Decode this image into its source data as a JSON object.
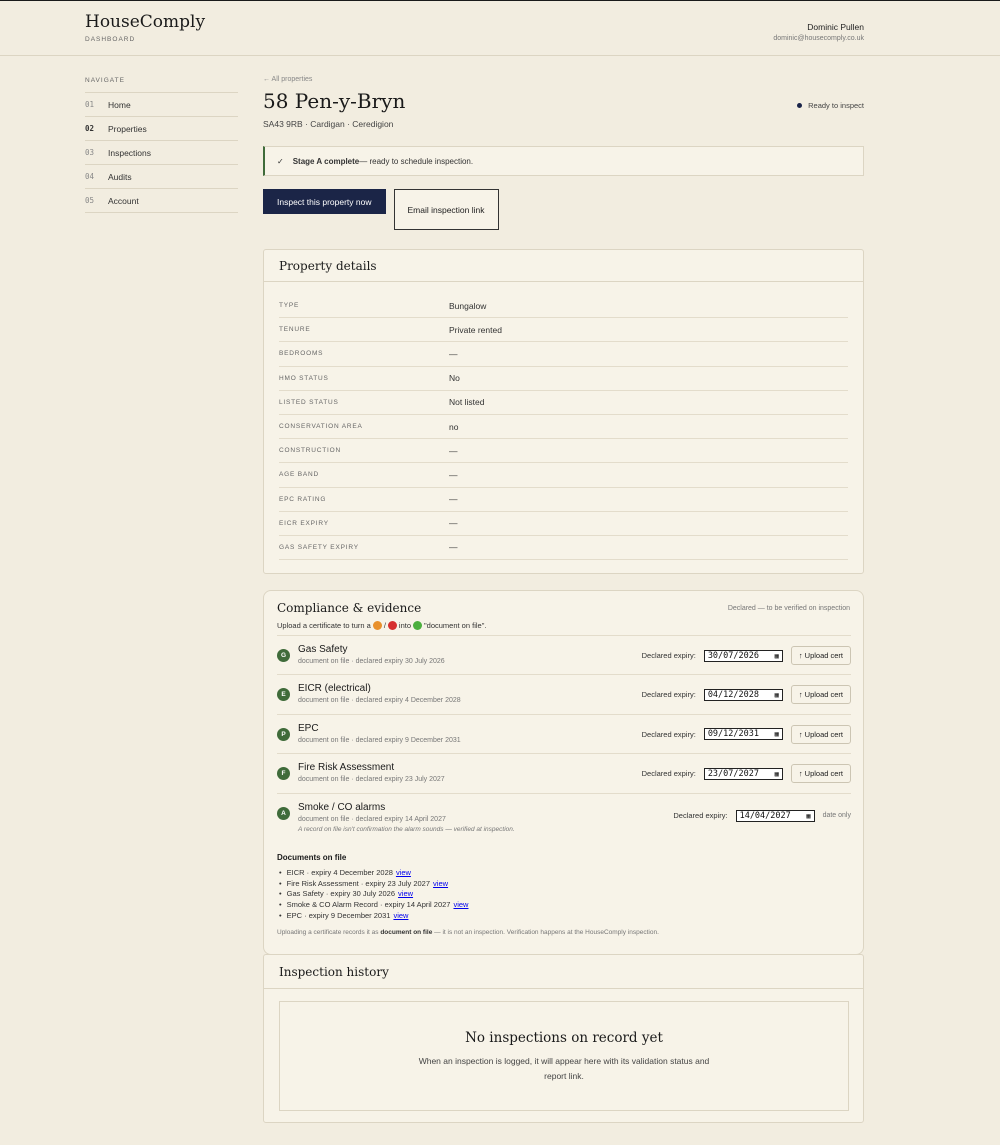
{
  "header": {
    "brand": "HouseComply",
    "section": "DASHBOARD",
    "user_name": "Dominic Pullen",
    "user_email": "dominic@housecomply.co.uk"
  },
  "nav": {
    "heading": "NAVIGATE",
    "items": [
      {
        "num": "01",
        "label": "Home",
        "active": false
      },
      {
        "num": "02",
        "label": "Properties",
        "active": true
      },
      {
        "num": "03",
        "label": "Inspections",
        "active": false
      },
      {
        "num": "04",
        "label": "Audits",
        "active": false
      },
      {
        "num": "05",
        "label": "Account",
        "active": false
      }
    ]
  },
  "property": {
    "back_link": "← All properties",
    "title": "58 Pen-y-Bryn",
    "subline": "SA43 9RB · Cardigan · Ceredigion",
    "status": "Ready to inspect",
    "banner_strong": "Stage A complete",
    "banner_rest": " — ready to schedule inspection.",
    "inspect_button": "Inspect this property now",
    "email_button": "Email inspection link"
  },
  "details": {
    "title": "Property details",
    "rows": [
      {
        "key": "TYPE",
        "value": "Bungalow"
      },
      {
        "key": "TENURE",
        "value": "Private rented"
      },
      {
        "key": "BEDROOMS",
        "value": "—"
      },
      {
        "key": "HMO STATUS",
        "value": "No"
      },
      {
        "key": "LISTED STATUS",
        "value": "Not listed"
      },
      {
        "key": "CONSERVATION AREA",
        "value": "no"
      },
      {
        "key": "CONSTRUCTION",
        "value": "—"
      },
      {
        "key": "AGE BAND",
        "value": "—"
      },
      {
        "key": "EPC RATING",
        "value": "—"
      },
      {
        "key": "EICR EXPIRY",
        "value": "—"
      },
      {
        "key": "GAS SAFETY EXPIRY",
        "value": "—"
      }
    ]
  },
  "compliance": {
    "title": "Compliance & evidence",
    "note": "Declared — to be verified on inspection",
    "help_prefix": "Upload a certificate to turn a",
    "help_mid": "into",
    "help_suffix": "\"document on file\".",
    "expiry_label": "Declared expiry:",
    "upload_label": "↑ Upload cert",
    "date_only": "date only",
    "items": [
      {
        "badge": "G",
        "name": "Gas Safety",
        "meta": "document on file · declared expiry 30 July 2026",
        "date": "30/07/2026",
        "upload": true
      },
      {
        "badge": "E",
        "name": "EICR (electrical)",
        "meta": "document on file · declared expiry 4 December 2028",
        "date": "04/12/2028",
        "upload": true
      },
      {
        "badge": "P",
        "name": "EPC",
        "meta": "document on file · declared expiry 9 December 2031",
        "date": "09/12/2031",
        "upload": true
      },
      {
        "badge": "F",
        "name": "Fire Risk Assessment",
        "meta": "document on file · declared expiry 23 July 2027",
        "date": "23/07/2027",
        "upload": true
      },
      {
        "badge": "A",
        "name": "Smoke / CO alarms",
        "meta": "document on file · declared expiry 14 April 2027",
        "date": "14/04/2027",
        "upload": false,
        "caveat": "A record on file isn't confirmation the alarm sounds — verified at inspection."
      }
    ],
    "docs_title": "Documents on file",
    "docs": [
      {
        "text": "EICR · expiry 4 December 2028",
        "link": "view"
      },
      {
        "text": "Fire Risk Assessment · expiry 23 July 2027",
        "link": "view"
      },
      {
        "text": "Gas Safety · expiry 30 July 2026",
        "link": "view"
      },
      {
        "text": "Smoke & CO Alarm Record · expiry 14 April 2027",
        "link": "view"
      },
      {
        "text": "EPC · expiry 9 December 2031",
        "link": "view"
      }
    ],
    "footer_prefix": "Uploading a certificate records it as ",
    "footer_strong": "document on file",
    "footer_suffix": " — it is not an inspection. Verification happens at the HouseComply inspection."
  },
  "history": {
    "title": "Inspection history",
    "empty_title": "No inspections on record yet",
    "empty_text": "When an inspection is logged, it will appear here with its validation status and report link."
  },
  "colors": {
    "accent": "#1b2547",
    "success": "#3f6b3a",
    "background": "#f2ede0",
    "card": "#f7f3e8"
  }
}
